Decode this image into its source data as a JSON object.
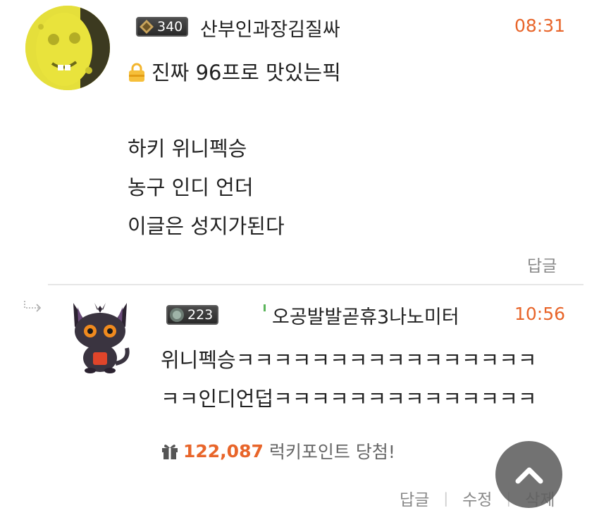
{
  "comment": {
    "level": "340",
    "nickname": "산부인과장김질싸",
    "time": "08:31",
    "first_line": "진짜 96프로 맛있는픽",
    "lines": [
      "하키 위니펙승",
      "농구 인디 언더",
      "이글은 성지가된다"
    ],
    "reply_label": "답글"
  },
  "reply": {
    "level": "223",
    "nickname": "오공발발곧휴3나노미터",
    "time": "10:56",
    "lines": [
      "위니펙승ㅋㅋㅋㅋㅋㅋㅋㅋㅋㅋㅋㅋㅋㅋㅋㅋ",
      "ㅋㅋ인디언덥ㅋㅋㅋㅋㅋㅋㅋㅋㅋㅋㅋㅋㅋㅋ"
    ],
    "lucky_points": "122,087",
    "lucky_text": "럭키포인트 당첨!",
    "actions": {
      "reply": "답글",
      "edit": "수정",
      "delete": "삭제"
    }
  },
  "colors": {
    "accent": "#e8652a",
    "muted": "#888888"
  },
  "icons": [
    "avatar-sponge",
    "level-badge-icon",
    "lock-icon",
    "reply-arrow-icon",
    "avatar-cat",
    "gift-icon",
    "chevron-up-icon"
  ]
}
